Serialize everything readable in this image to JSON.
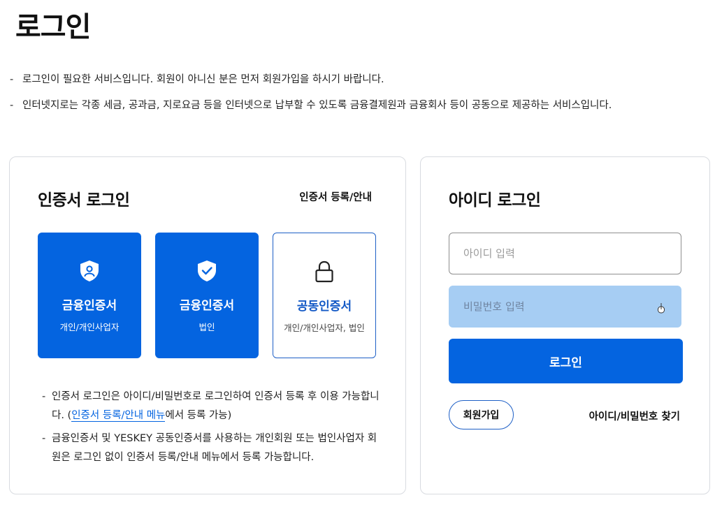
{
  "page": {
    "title": "로그인",
    "notices": [
      "로그인이 필요한 서비스입니다. 회원이 아니신 분은 먼저 회원가입을 하시기 바랍니다.",
      "인터넷지로는 각종 세금, 공과금, 지로요금 등을 인터넷으로 납부할 수 있도록 금융결제원과 금융회사 등이 공동으로 제공하는 서비스입니다."
    ]
  },
  "cert_login": {
    "title": "인증서 로그인",
    "guide_link": "인증서 등록/안내",
    "tiles": [
      {
        "title": "금융인증서",
        "sub": "개인/개인사업자",
        "icon": "shield-person-icon"
      },
      {
        "title": "금융인증서",
        "sub": "법인",
        "icon": "shield-check-icon"
      },
      {
        "title": "공동인증서",
        "sub": "개인/개인사업자, 법인",
        "icon": "lock-icon"
      }
    ],
    "notes": {
      "note1_before": "인증서 로그인은 아이디/비밀번호로 로그인하여 인증서 등록 후 이용 가능합니다. (",
      "note1_link": "인증서 등록/안내 메뉴",
      "note1_after": "에서 등록 가능)",
      "note2": "금융인증서 및 YESKEY 공동인증서를 사용하는 개인회원 또는 법인사업자 회원은 로그인 없이 인증서 등록/안내 메뉴에서 등록 가능합니다."
    }
  },
  "id_login": {
    "title": "아이디 로그인",
    "id_placeholder": "아이디 입력",
    "pw_placeholder": "비밀번호 입력",
    "login_label": "로그인",
    "signup_label": "회원가입",
    "find_label": "아이디/비밀번호 찾기"
  },
  "colors": {
    "primary": "#0464e0",
    "outline": "#1d5fc6",
    "pw_field_bg": "#a6cdf3"
  }
}
